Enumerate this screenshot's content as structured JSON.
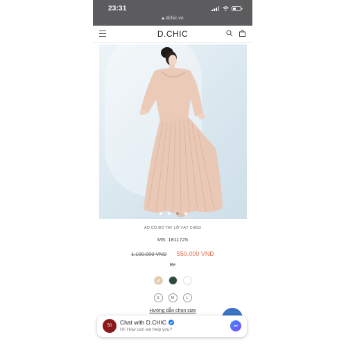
{
  "status_bar": {
    "time": "23:31",
    "url": "dchic.vn"
  },
  "header": {
    "brand": "D.CHIC"
  },
  "product": {
    "name": "ÁO CỔ ĐỔ TAY LỠ VẠT CHÉO",
    "sku": "MS: 1811725",
    "old_price": "1.100.000 VNĐ",
    "new_price": "550.000 VNĐ",
    "color_label": "Be",
    "colors": [
      "#e8c9a8",
      "#2f4a3a",
      "#ffffff"
    ],
    "sizes": [
      "S",
      "M",
      "L"
    ],
    "size_guide": "Hướng dẫn chọn size",
    "carousel": {
      "count": 4,
      "active": 3
    }
  },
  "chat": {
    "title": "Chat with D.CHIC",
    "subtitle": "Hi! How can we help you?",
    "avatar_text": "50"
  }
}
